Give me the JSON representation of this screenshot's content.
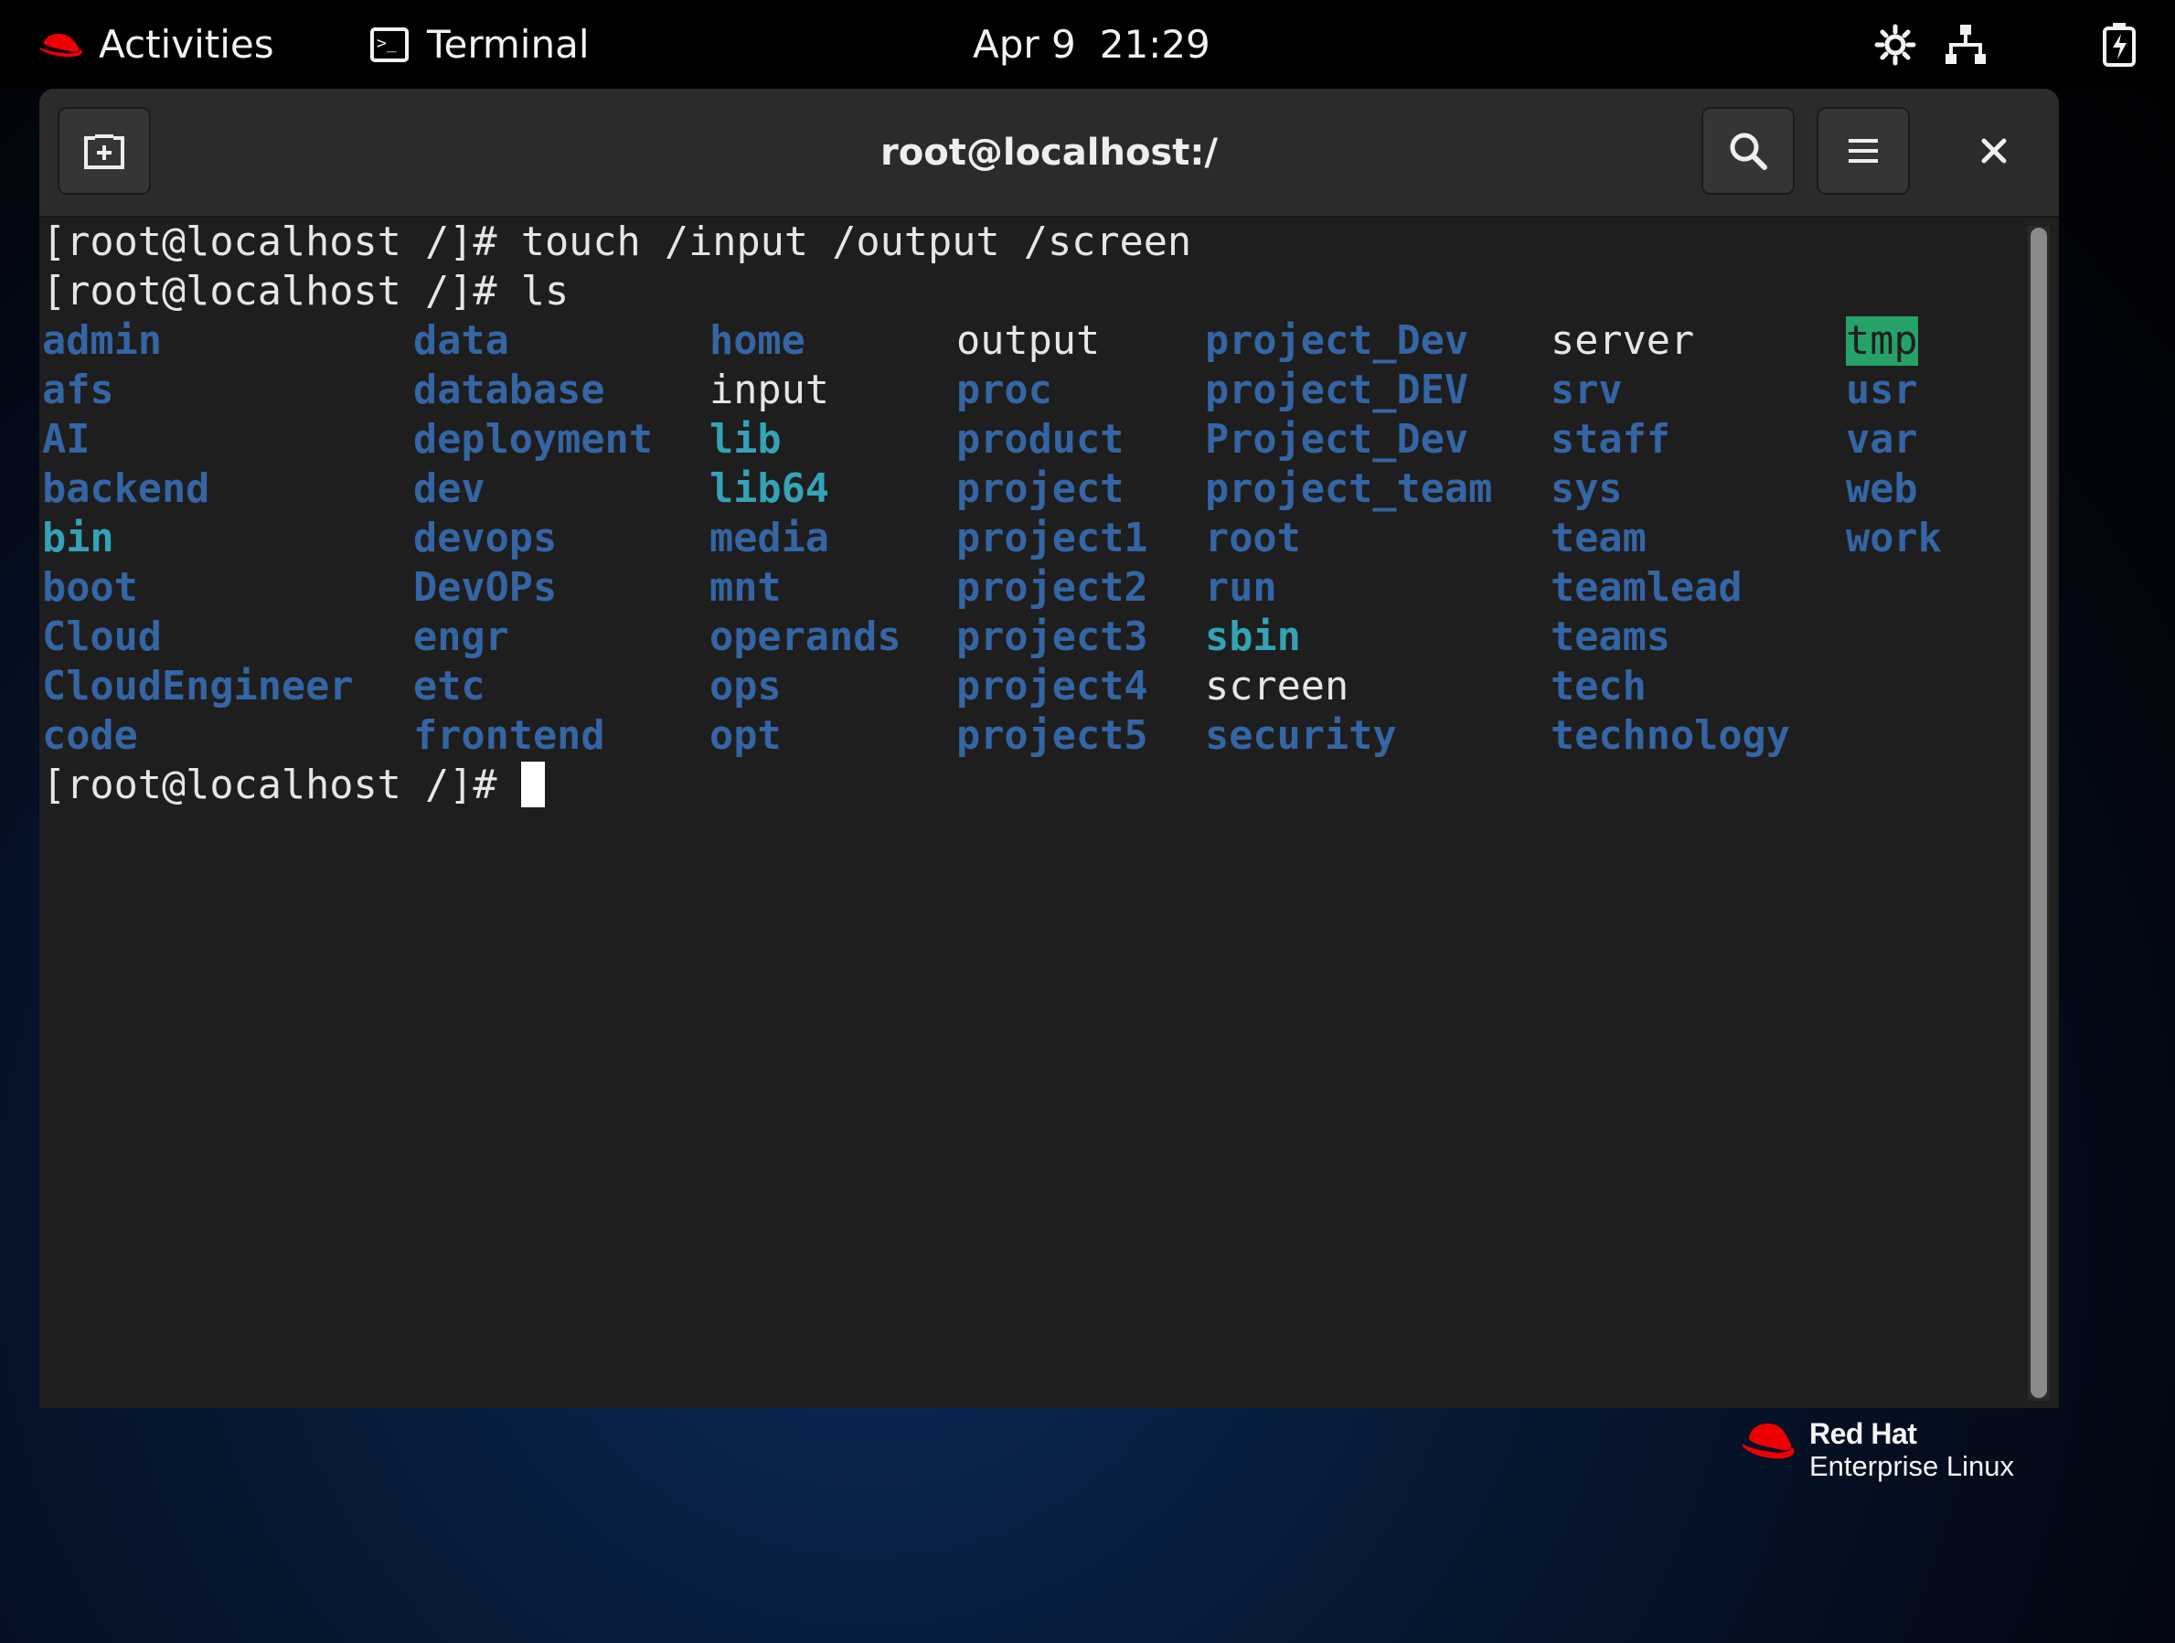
{
  "topbar": {
    "activities_label": "Activities",
    "app_label": "Terminal",
    "app_icon_glyph": ">_",
    "date": "Apr 9",
    "time": "21:29"
  },
  "window": {
    "title": "root@localhost:/"
  },
  "terminal": {
    "lines": [
      "[root@localhost /]# touch /input /output /screen",
      "[root@localhost /]# ls"
    ],
    "prompt": "[root@localhost /]# ",
    "listing_columns": [
      [
        {
          "name": "admin",
          "type": "dir"
        },
        {
          "name": "afs",
          "type": "dir"
        },
        {
          "name": "AI",
          "type": "dir"
        },
        {
          "name": "backend",
          "type": "dir"
        },
        {
          "name": "bin",
          "type": "link"
        },
        {
          "name": "boot",
          "type": "dir"
        },
        {
          "name": "Cloud",
          "type": "dir"
        },
        {
          "name": "CloudEngineer",
          "type": "dir"
        },
        {
          "name": "code",
          "type": "dir"
        }
      ],
      [
        {
          "name": "data",
          "type": "dir"
        },
        {
          "name": "database",
          "type": "dir"
        },
        {
          "name": "deployment",
          "type": "dir"
        },
        {
          "name": "dev",
          "type": "dir"
        },
        {
          "name": "devops",
          "type": "dir"
        },
        {
          "name": "DevOPs",
          "type": "dir"
        },
        {
          "name": "engr",
          "type": "dir"
        },
        {
          "name": "etc",
          "type": "dir"
        },
        {
          "name": "frontend",
          "type": "dir"
        }
      ],
      [
        {
          "name": "home",
          "type": "dir"
        },
        {
          "name": "input",
          "type": "file"
        },
        {
          "name": "lib",
          "type": "link"
        },
        {
          "name": "lib64",
          "type": "link"
        },
        {
          "name": "media",
          "type": "dir"
        },
        {
          "name": "mnt",
          "type": "dir"
        },
        {
          "name": "operands",
          "type": "dir"
        },
        {
          "name": "ops",
          "type": "dir"
        },
        {
          "name": "opt",
          "type": "dir"
        }
      ],
      [
        {
          "name": "output",
          "type": "file"
        },
        {
          "name": "proc",
          "type": "dir"
        },
        {
          "name": "product",
          "type": "dir"
        },
        {
          "name": "project",
          "type": "dir"
        },
        {
          "name": "project1",
          "type": "dir"
        },
        {
          "name": "project2",
          "type": "dir"
        },
        {
          "name": "project3",
          "type": "dir"
        },
        {
          "name": "project4",
          "type": "dir"
        },
        {
          "name": "project5",
          "type": "dir"
        }
      ],
      [
        {
          "name": "project_Dev",
          "type": "dir"
        },
        {
          "name": "project_DEV",
          "type": "dir"
        },
        {
          "name": "Project_Dev",
          "type": "dir"
        },
        {
          "name": "project_team",
          "type": "dir"
        },
        {
          "name": "root",
          "type": "dir"
        },
        {
          "name": "run",
          "type": "dir"
        },
        {
          "name": "sbin",
          "type": "link"
        },
        {
          "name": "screen",
          "type": "file"
        },
        {
          "name": "security",
          "type": "dir"
        }
      ],
      [
        {
          "name": "server",
          "type": "file"
        },
        {
          "name": "srv",
          "type": "dir"
        },
        {
          "name": "staff",
          "type": "dir"
        },
        {
          "name": "sys",
          "type": "dir"
        },
        {
          "name": "team",
          "type": "dir"
        },
        {
          "name": "teamlead",
          "type": "dir"
        },
        {
          "name": "teams",
          "type": "dir"
        },
        {
          "name": "tech",
          "type": "dir"
        },
        {
          "name": "technology",
          "type": "dir"
        }
      ],
      [
        {
          "name": "tmp",
          "type": "sticky"
        },
        {
          "name": "usr",
          "type": "dir"
        },
        {
          "name": "var",
          "type": "dir"
        },
        {
          "name": "web",
          "type": "dir"
        },
        {
          "name": "work",
          "type": "dir"
        }
      ]
    ]
  },
  "branding": {
    "brand": "Red Hat",
    "product": "Enterprise Linux"
  },
  "colors": {
    "directory": "#3465a4",
    "symlink": "#34a3b6",
    "file": "#e6e6e6",
    "sticky_bg": "#26a269",
    "redhat_red": "#ee0000"
  },
  "icons": {
    "activities": "redhat-hat-icon",
    "new_tab": "new-tab-icon",
    "search": "search-icon",
    "menu": "hamburger-menu-icon",
    "close": "close-icon",
    "accessibility": "accessibility-icon",
    "network": "network-icon",
    "battery": "battery-charging-icon"
  }
}
